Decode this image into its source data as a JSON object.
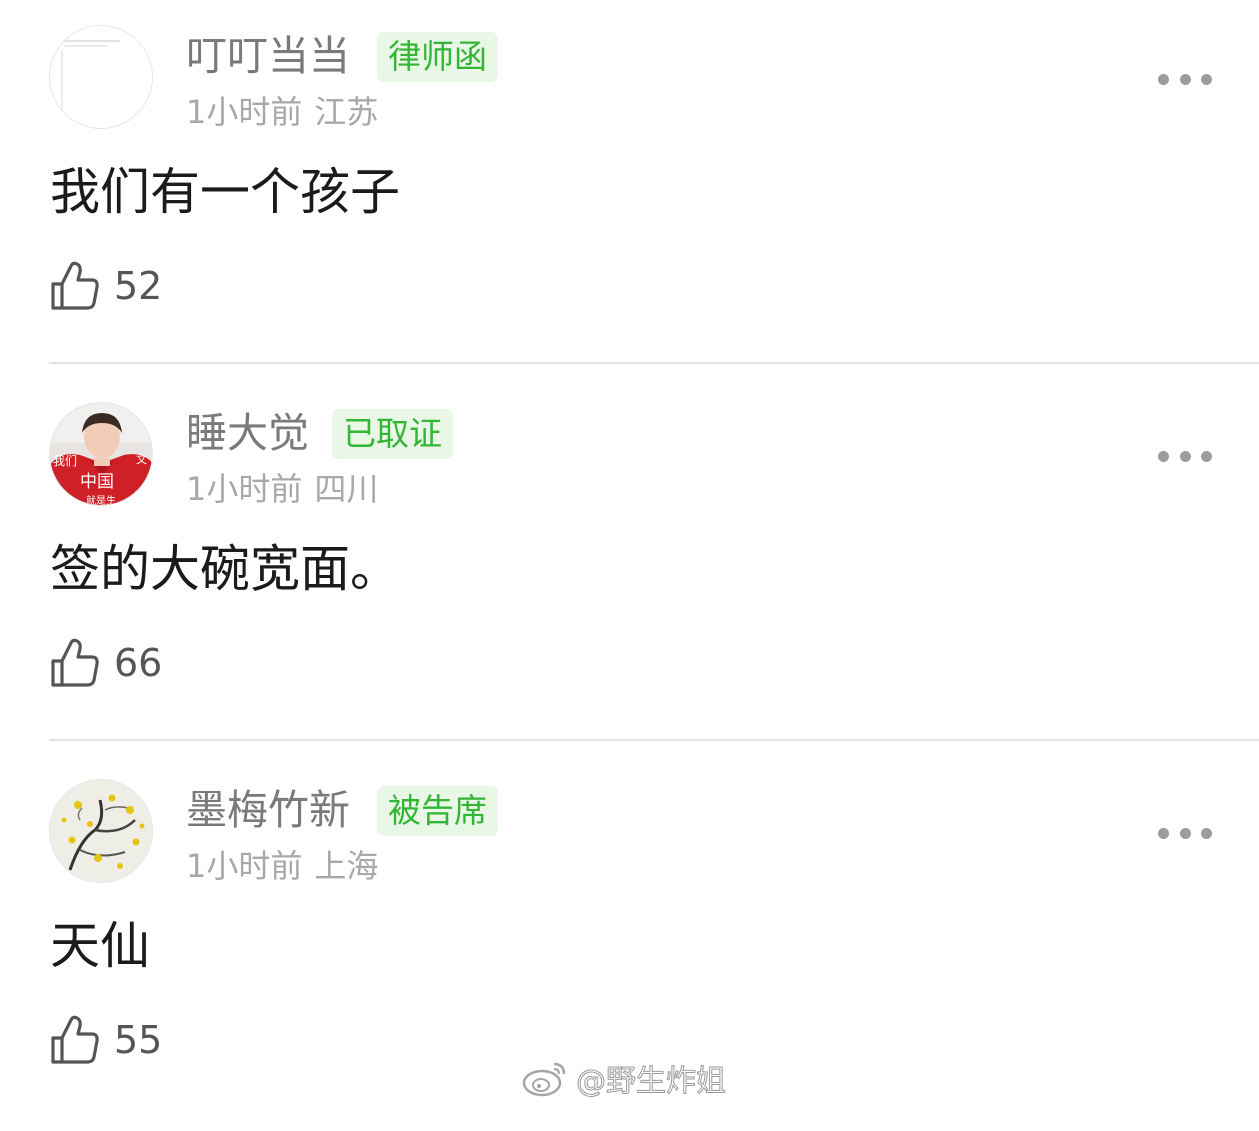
{
  "comments": [
    {
      "username": "叮叮当当",
      "badge": "律师函",
      "time": "1小时前",
      "location": "江苏",
      "text": "我们有一个孩子",
      "likes": "52",
      "avatar": "blank-document"
    },
    {
      "username": "睡大觉",
      "badge": "已取证",
      "time": "1小时前",
      "location": "四川",
      "text": "签的大碗宽面。",
      "likes": "66",
      "avatar": "person-red-jacket",
      "avatar_text": [
        "我们",
        "文",
        "中国",
        "就是生"
      ]
    },
    {
      "username": "墨梅竹新",
      "badge": "被告席",
      "time": "1小时前",
      "location": "上海",
      "text": "天仙",
      "likes": "55",
      "avatar": "ink-plum-painting"
    }
  ],
  "watermark": {
    "text": "@野生炸姐",
    "icon": "weibo-icon"
  },
  "colors": {
    "badge_bg": "#e9f7e6",
    "badge_text": "#33b536",
    "username": "#7a7a7a",
    "meta": "#a8a8a8",
    "body_text": "#1b1b1b"
  }
}
